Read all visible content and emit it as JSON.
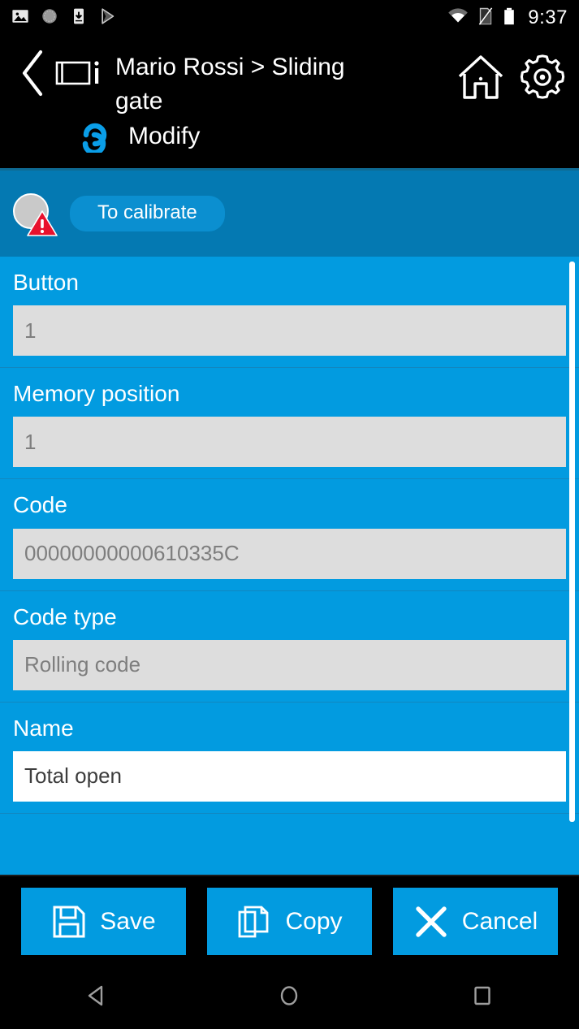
{
  "status_bar": {
    "time": "9:37",
    "left_icons": [
      "image-icon",
      "circle-progress-icon",
      "download-to-device-icon",
      "play-store-icon"
    ],
    "right_icons": [
      "wifi-icon",
      "no-sim-icon",
      "battery-icon"
    ]
  },
  "header": {
    "back_icon": "back-chevron-icon",
    "device_icon": "device-info-icon",
    "title": "Mario Rossi > Sliding gate",
    "home_icon": "home-icon",
    "settings_icon": "gear-icon",
    "mode_icon": "cycle-loop-icon",
    "mode_label": "Modify"
  },
  "status_strip": {
    "avatar_icon": "avatar-circle-icon",
    "warning_icon": "warning-triangle-icon",
    "badge_label": "To calibrate"
  },
  "form": {
    "fields": [
      {
        "label": "Button",
        "value": "1",
        "editable": false
      },
      {
        "label": "Memory position",
        "value": "1",
        "editable": false
      },
      {
        "label": "Code",
        "value": "00000000000610335C",
        "editable": false
      },
      {
        "label": "Code type",
        "value": "Rolling code",
        "editable": false
      },
      {
        "label": "Name",
        "value": "Total open",
        "editable": true
      }
    ]
  },
  "actions": {
    "save_label": "Save",
    "save_icon": "floppy-save-icon",
    "copy_label": "Copy",
    "copy_icon": "copy-pages-icon",
    "cancel_label": "Cancel",
    "cancel_icon": "close-x-icon"
  },
  "nav_bar": {
    "back_icon": "nav-back-triangle-icon",
    "home_icon": "nav-home-circle-icon",
    "recents_icon": "nav-recents-square-icon"
  },
  "colors": {
    "accent_blue": "#029be0",
    "strip_blue": "#0479b2",
    "pill_blue": "#0b8fd0",
    "warning_red": "#e8112d",
    "black": "#000000"
  }
}
